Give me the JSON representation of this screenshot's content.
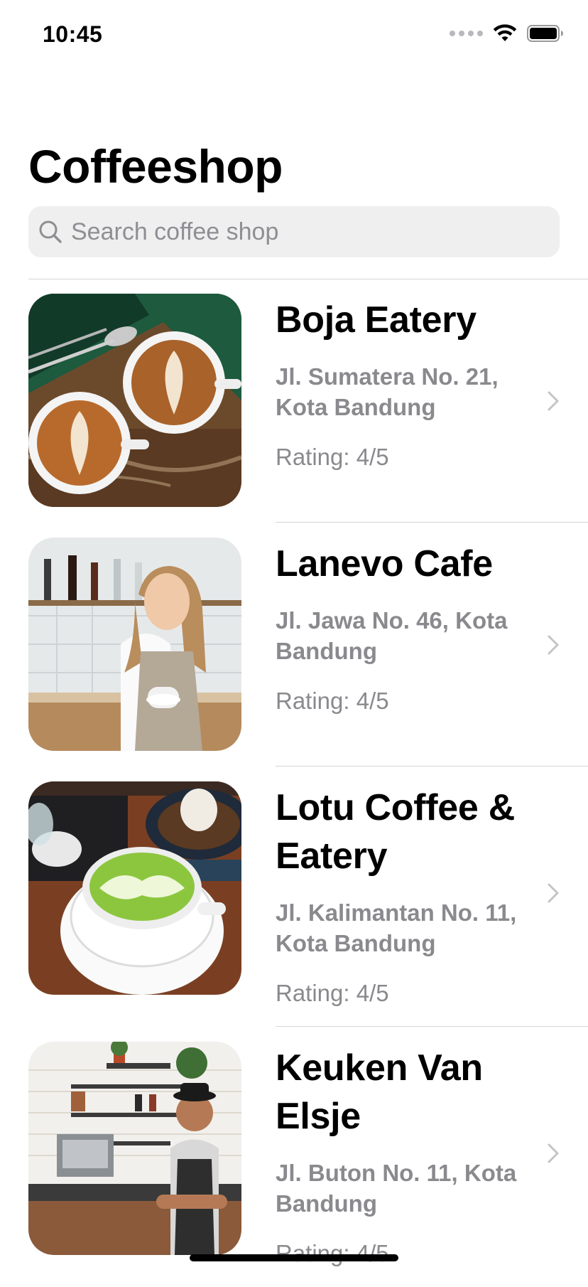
{
  "status_bar": {
    "time": "10:45"
  },
  "page": {
    "title": "Coffeeshop"
  },
  "search": {
    "placeholder": "Search coffee shop",
    "value": ""
  },
  "shops": [
    {
      "name": "Boja Eatery",
      "address": "Jl. Sumatera No. 21, Kota Bandung",
      "rating": "Rating: 4/5",
      "image": "latte-art-cups-photo"
    },
    {
      "name": "Lanevo Cafe",
      "address": "Jl. Jawa No. 46, Kota Bandung",
      "rating": "Rating: 4/5",
      "image": "barista-woman-photo"
    },
    {
      "name": "Lotu Coffee & Eatery",
      "address": "Jl. Kalimantan No. 11, Kota Bandung",
      "rating": "Rating: 4/5",
      "image": "matcha-latte-photo"
    },
    {
      "name": "Keuken Van Elsje",
      "address": "Jl. Buton No. 11, Kota Bandung",
      "rating": "Rating: 4/5",
      "image": "barista-man-photo"
    }
  ],
  "colors": {
    "secondary_text": "#8a8a8e",
    "search_bg": "#efeff0",
    "divider": "#d6d6d9"
  }
}
